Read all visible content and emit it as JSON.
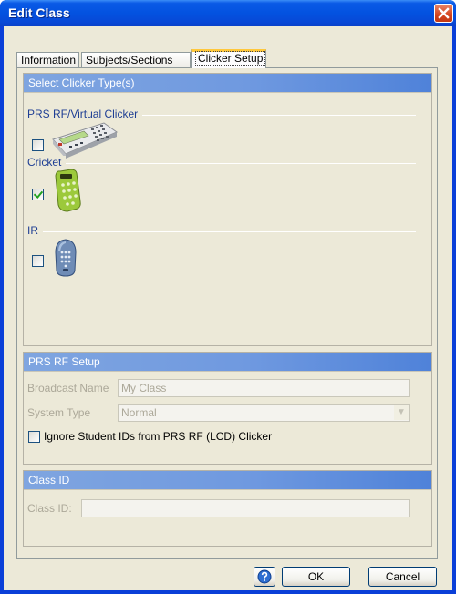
{
  "window": {
    "title": "Edit Class"
  },
  "tabs": [
    {
      "label": "Information"
    },
    {
      "label": "Subjects/Sections"
    },
    {
      "label": "Clicker Setup"
    }
  ],
  "clicker_panel": {
    "header": "Select Clicker Type(s)",
    "groups": [
      {
        "label": "PRS RF/Virtual Clicker",
        "checked": false,
        "icon": "prs-rf-clicker-icon"
      },
      {
        "label": "Cricket",
        "checked": true,
        "icon": "cricket-clicker-icon"
      },
      {
        "label": "IR",
        "checked": false,
        "icon": "ir-clicker-icon"
      }
    ]
  },
  "prs_panel": {
    "header": "PRS RF Setup",
    "broadcast_label": "Broadcast Name",
    "broadcast_value": "My Class",
    "system_type_label": "System Type",
    "system_type_value": "Normal",
    "ignore_ids_label": "Ignore Student IDs from PRS RF (LCD) Clicker",
    "ignore_ids_checked": false
  },
  "class_id_panel": {
    "header": "Class ID",
    "field_label": "Class ID:",
    "field_value": ""
  },
  "buttons": {
    "help_icon": "help-icon",
    "ok": "OK",
    "cancel": "Cancel"
  }
}
